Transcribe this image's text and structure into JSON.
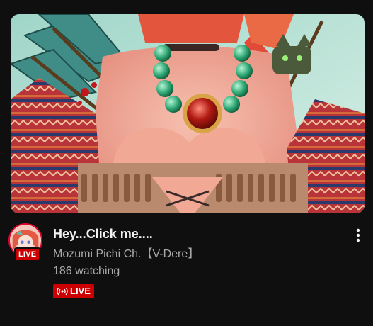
{
  "video": {
    "title": "Hey...Click me....",
    "channel": "Mozumi Pichi Ch.【V-Dere】",
    "viewers": "186 watching",
    "live_badge": "LIVE",
    "avatar_live_label": "LIVE"
  },
  "icons": {
    "menu": "more-vert-icon",
    "live": "live-broadcast-icon"
  },
  "colors": {
    "background": "#0f0f0f",
    "live_red": "#cc0000",
    "text_primary": "#f1f1f1",
    "text_secondary": "#aaaaaa"
  }
}
